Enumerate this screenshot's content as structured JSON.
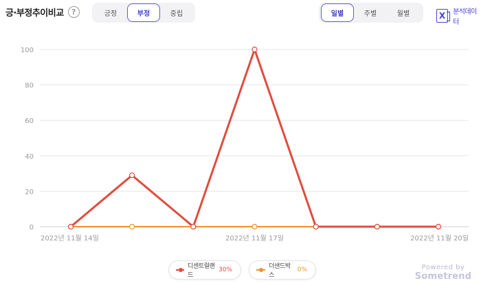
{
  "header": {
    "title": "긍·부정추이비교",
    "help_glyph": "?",
    "sentiment_tabs": [
      {
        "label": "긍정",
        "active": false
      },
      {
        "label": "부정",
        "active": true
      },
      {
        "label": "중립",
        "active": false
      }
    ],
    "period_tabs": [
      {
        "label": "일별",
        "active": true
      },
      {
        "label": "주별",
        "active": false
      },
      {
        "label": "월별",
        "active": false
      }
    ],
    "export_icon": "excel-icon",
    "export_glyph": "X",
    "export_label": "분석데이터"
  },
  "chart_data": {
    "type": "line",
    "x": [
      "2022-11-14",
      "2022-11-15",
      "2022-11-16",
      "2022-11-17",
      "2022-11-18",
      "2022-11-19",
      "2022-11-20"
    ],
    "x_tick_labels": [
      "2022년 11월 14일",
      "2022년 11월 17일",
      "2022년 11월 20일"
    ],
    "y_ticks": [
      0,
      20,
      40,
      60,
      80,
      100
    ],
    "ylim": [
      0,
      100
    ],
    "grid": true,
    "legend_position": "bottom-center",
    "series": [
      {
        "name": "디센트럴랜드",
        "pct": "30%",
        "color": "#e04b3d",
        "values": [
          0,
          29,
          0,
          100,
          0,
          0,
          0
        ]
      },
      {
        "name": "더샌드박스",
        "pct": "0%",
        "color": "#f0912e",
        "values": [
          0,
          0,
          0,
          0,
          0,
          0,
          0
        ]
      }
    ]
  },
  "footer": {
    "powered_by": "Powered by",
    "brand": "Sometrend"
  }
}
